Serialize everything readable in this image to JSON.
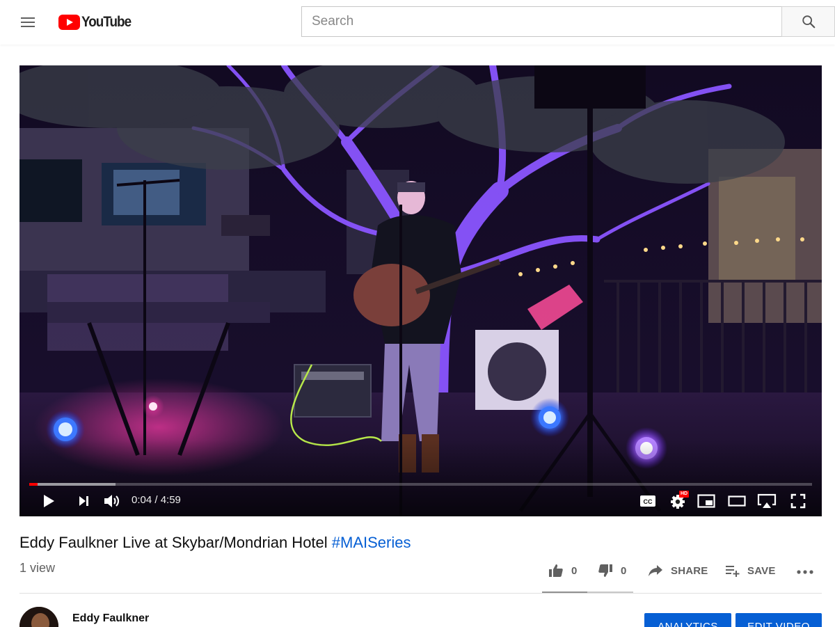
{
  "brand": {
    "logo_text": "YouTube",
    "accent": "#ff0000"
  },
  "search": {
    "placeholder": "Search",
    "value": ""
  },
  "player": {
    "time_display": "0:04 / 4:59",
    "played_fraction": 0.011,
    "buffered_fraction": 0.11,
    "hd_badge": "HD"
  },
  "video": {
    "title": "Eddy Faulkner Live at Skybar/Mondrian Hotel ",
    "hashtag": "#MAISeries",
    "views": "1 view"
  },
  "actions": {
    "like_count": "0",
    "dislike_count": "0",
    "share_label": "SHARE",
    "save_label": "SAVE"
  },
  "channel": {
    "name": "Eddy Faulkner",
    "analytics_label": "ANALYTICS",
    "edit_label": "EDIT VIDEO"
  },
  "colors": {
    "link": "#065fd4",
    "button": "#065fd4"
  }
}
